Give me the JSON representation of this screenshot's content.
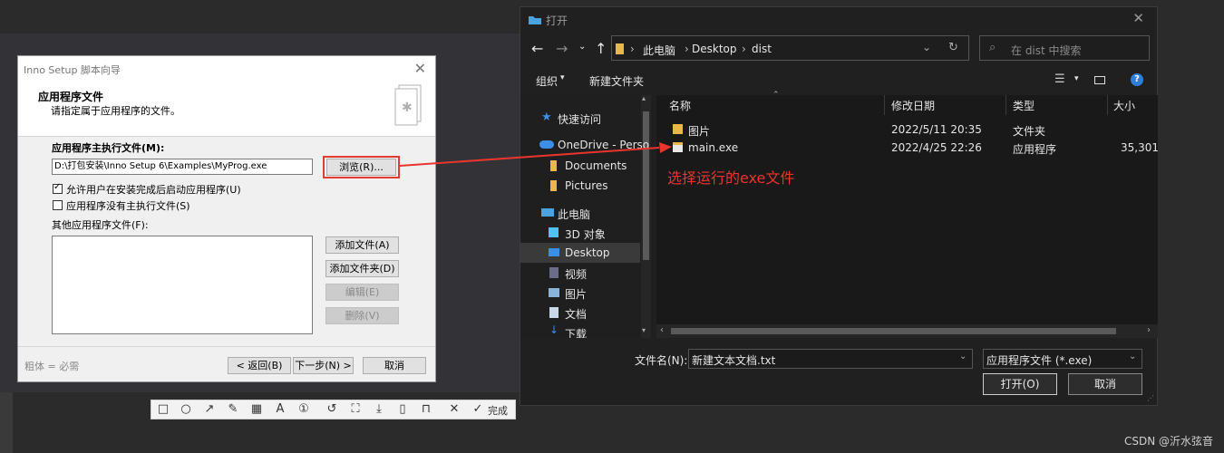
{
  "wizard": {
    "title": "Inno Setup 脚本向导",
    "header_title": "应用程序文件",
    "header_subtitle": "请指定属于应用程序的文件。",
    "main_exe_label": "应用程序主执行文件(M):",
    "main_exe_value": "D:\\打包安装\\Inno Setup 6\\Examples\\MyProg.exe",
    "browse_label": "浏览(R)...",
    "allow_run_label": "允许用户在安装完成后启动应用程序(U)",
    "no_main_exe_label": "应用程序没有主执行文件(S)",
    "other_files_label": "其他应用程序文件(F):",
    "add_files_label": "添加文件(A)",
    "add_folder_label": "添加文件夹(D)",
    "edit_label": "编辑(E)",
    "remove_label": "删除(V)",
    "footer_note": "粗体 = 必需",
    "back_label": "< 返回(B)",
    "next_label": "下一步(N) >",
    "cancel_label": "取消"
  },
  "dialog": {
    "title": "打开",
    "breadcrumb": [
      "此电脑",
      "Desktop",
      "dist"
    ],
    "search_placeholder": "在 dist 中搜索",
    "organize_label": "组织",
    "new_folder_label": "新建文件夹",
    "nav_items": [
      {
        "label": "快速访问",
        "icon": "star-icon"
      },
      {
        "label": "OneDrive - Perso",
        "icon": "cloud-icon"
      },
      {
        "label": "Documents",
        "icon": "folder-icon"
      },
      {
        "label": "Pictures",
        "icon": "folder-icon"
      },
      {
        "label": "此电脑",
        "icon": "computer-icon"
      },
      {
        "label": "3D 对象",
        "icon": "cube-icon"
      },
      {
        "label": "Desktop",
        "icon": "desktop-icon"
      },
      {
        "label": "视频",
        "icon": "video-icon"
      },
      {
        "label": "图片",
        "icon": "picture-icon"
      },
      {
        "label": "文档",
        "icon": "document-icon"
      },
      {
        "label": "下载",
        "icon": "download-icon"
      }
    ],
    "columns": [
      "名称",
      "修改日期",
      "类型",
      "大小"
    ],
    "rows": [
      {
        "name": "图片",
        "date": "2022/5/11 20:35",
        "type": "文件夹",
        "size": ""
      },
      {
        "name": "main.exe",
        "date": "2022/4/25 22:26",
        "type": "应用程序",
        "size": "35,301"
      }
    ],
    "filename_label": "文件名(N):",
    "filename_value": "新建文本文档.txt",
    "filter_value": "应用程序文件 (*.exe)",
    "open_label": "打开(O)",
    "cancel_label": "取消"
  },
  "annotation": {
    "text": "选择运行的exe文件",
    "color": "#e8352e"
  },
  "screenshot_toolbar": {
    "done_label": "完成"
  },
  "watermark": "CSDN @沂水弦音"
}
